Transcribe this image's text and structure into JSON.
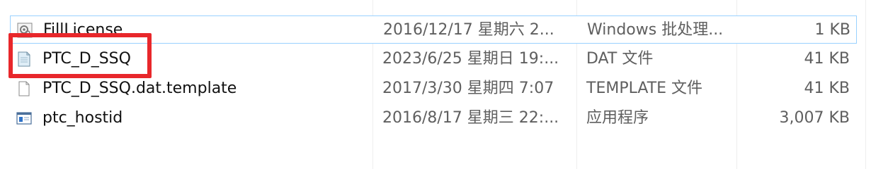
{
  "files": [
    {
      "name": "FillLicense",
      "modified": "2016/12/17 星期六 2...",
      "type": "Windows 批处理...",
      "size": "1 KB",
      "icon": "batch-file-gear-icon"
    },
    {
      "name": "PTC_D_SSQ",
      "modified": "2023/6/25 星期日 19:...",
      "type": "DAT 文件",
      "size": "41 KB",
      "icon": "dat-file-icon"
    },
    {
      "name": "PTC_D_SSQ.dat.template",
      "modified": "2017/3/30 星期四 7:07",
      "type": "TEMPLATE 文件",
      "size": "41 KB",
      "icon": "blank-file-icon"
    },
    {
      "name": "ptc_hostid",
      "modified": "2016/8/17 星期三 22:...",
      "type": "应用程序",
      "size": "3,007 KB",
      "icon": "application-window-icon"
    }
  ],
  "colors": {
    "highlight": "#e8272b",
    "selection_border": "#99d1ff"
  }
}
